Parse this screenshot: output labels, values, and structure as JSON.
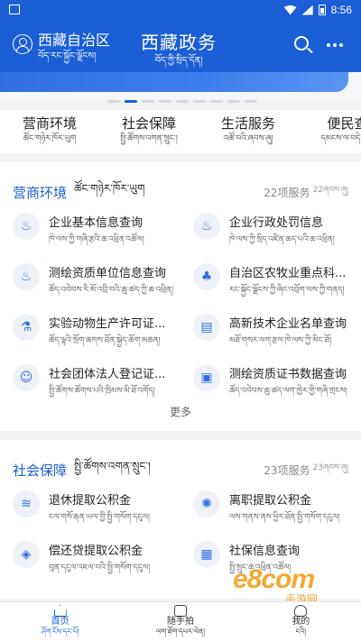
{
  "status_bar": {
    "time": "8:56"
  },
  "header": {
    "region_zh": "西藏自治区",
    "region_bo": "བོད་རང་སྐྱོང་ལྗོངས།",
    "title_zh": "西藏政务",
    "title_bo": "བོད་ཀྱི་སྲིད་དོན།",
    "search_icon": "search-icon",
    "more_icon": "more-dots-icon"
  },
  "banner": {
    "dots": 9,
    "active_dot": 1
  },
  "categories": [
    {
      "zh": "营商环境",
      "bo": "ཚོང་གཉེར་ཁོར་ཡུག"
    },
    {
      "zh": "社会保障",
      "bo": "སྤྱི་ཚོགས་འགན་སྲུང་།"
    },
    {
      "zh": "生活服务",
      "bo": "འཚོ་བའི་ཞབས་ཞུ།"
    },
    {
      "zh": "便民查",
      "bo": "དམངས་ལ་བདེ་བའི་"
    }
  ],
  "section1": {
    "title_zh": "营商环境",
    "title_bo": "ཚོང་གཉེར་ཁོར་ཡུག",
    "count": "22项服务",
    "count_bo": "22ཞབས་ཞུ།",
    "items": [
      {
        "icon": "flame-icon",
        "zh": "企业基本信息查询",
        "bo": "ཁེ་ལས་ཀྱི་གཞི་རྩའི་ཆ་འཕྲིན་འཚོལ།"
      },
      {
        "icon": "flame-icon",
        "zh": "企业行政处罚信息",
        "bo": "ཁེ་ལས་ཀྱི་སྲིད་འཛིན་ཆད་པའི་ཆ་འཕྲིན།"
      },
      {
        "icon": "flame-icon",
        "zh": "测绘资质单位信息查询",
        "bo": "ཚོད་འབེབས་རི་མོ་འབྲི་བའི་ཆུ་ཚད་ཀྱི་ཆ་འཕྲིན།"
      },
      {
        "icon": "plant-icon",
        "zh": "自治区农牧业重点科...",
        "bo": "རང་སྐྱོང་ལྗོངས་ཀྱི་ཞིང་འབྲོག་ལས་ཀྱི་གནད།"
      },
      {
        "icon": "flask-icon",
        "zh": "实验动物生产许可证...",
        "bo": "ཚོད་ལྟའི་སྲོག་ཆགས་ཐོན་སྐྱེད་ཆོག་མཆན།"
      },
      {
        "icon": "chart-icon",
        "zh": "高新技术企业名单查询",
        "bo": "མཐོ་གསར་ལག་རྩལ་ཁེ་ལས་ཀྱི་མིང་ཐོ།"
      },
      {
        "icon": "people-icon",
        "zh": "社会团体法人登记证...",
        "bo": "སྤྱི་ཚོགས་ཚོགས་པའི་ཁྲིམས་མི་ཐོ་འགོད།"
      },
      {
        "icon": "certificate-icon",
        "zh": "测绘资质证书数据查询",
        "bo": "ཚོད་འབེབས་ཆུ་ཚད་ལག་ཁྱེར་གྱི་གཞི་གྲངས།"
      }
    ],
    "more": "更多"
  },
  "section2": {
    "title_zh": "社会保障",
    "title_bo": "སྤྱི་ཚོགས་འགན་སྲུང་།",
    "count": "23项服务",
    "count_bo": "23ཞབས་ཞུ།",
    "items": [
      {
        "icon": "layers-icon",
        "zh": "退休提取公积金",
        "bo": "ངལ་གསོ་རྒན་ཡལ་གྱི་སྤྱི་གསོག་དངུལ།"
      },
      {
        "icon": "aperture-icon",
        "zh": "离职提取公积金",
        "bo": "ལས་གནས་ནས་ཕྱིར་ཐོན་སྤྱི་གསོག་དངུལ།"
      },
      {
        "icon": "box-icon",
        "zh": "偿还贷提取公积金",
        "bo": "བུན་དངུལ་འཇལ་བའི་སྤྱི་གསོག་དངུལ།"
      },
      {
        "icon": "id-card-icon",
        "zh": "社保信息查询",
        "bo": "སྤྱི་སྲུང་ཆ་འཕྲིན་འཚོལ།"
      }
    ]
  },
  "tabbar": [
    {
      "icon": "home-icon",
      "zh": "首页",
      "bo": "ཤོག་ངོས་དང་པོ།"
    },
    {
      "icon": "camera-icon",
      "zh": "随手拍",
      "bo": "ལག་ཐོག་དཔར་ལེན།"
    },
    {
      "icon": "user-icon",
      "zh": "我的",
      "bo": "ངའི།"
    }
  ],
  "watermark": {
    "big": "e8com",
    "small": "手游网"
  }
}
